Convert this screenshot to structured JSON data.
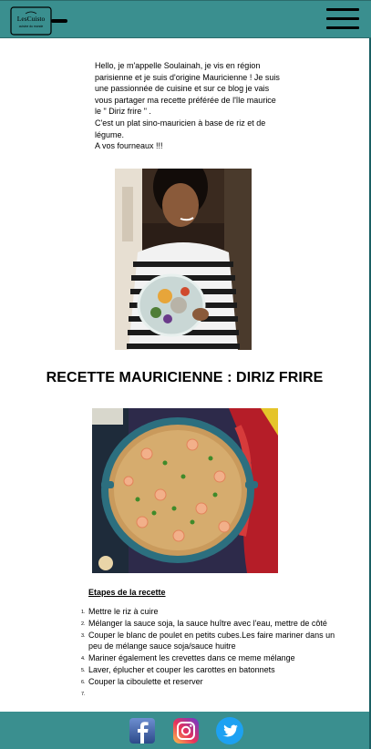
{
  "header": {
    "logo_text": "LesCuisto",
    "logo_subtext": "cuisine du monde",
    "menu_icon": "hamburger-icon"
  },
  "intro": {
    "p1": "Hello, je m'appelle Soulainah, je vis en région parisienne et je suis d'origine Mauricienne ! Je suis une passionnée de cuisine et sur ce blog je vais vous partager ma recette préférée de l'île maurice le \" Diriz frire \" .",
    "p2": "C'est un plat sino-mauricien à base de riz et de légume.",
    "p3": "A vos fourneaux !!!"
  },
  "title": "RECETTE MAURICIENNE : DIRIZ FRIRE",
  "steps": {
    "heading": "Etapes de la recette",
    "items": [
      {
        "num": "1.",
        "text": "Mettre le riz à cuire"
      },
      {
        "num": "2.",
        "text": "Mélanger la sauce soja, la sauce huître avec l'eau, mettre de côté"
      },
      {
        "num": "3.",
        "text": "Couper le blanc de poulet en petits cubes.Les faire mariner dans un peu de mélange sauce soja/sauce huitre"
      },
      {
        "num": "4.",
        "text": "Mariner également les crevettes dans ce meme mélange"
      },
      {
        "num": "5.",
        "text": "Laver, éplucher et couper les carottes en batonnets"
      },
      {
        "num": "6.",
        "text": "Couper la ciboulette et reserver"
      },
      {
        "num": "7.",
        "text": ""
      }
    ]
  },
  "footer": {
    "icons": [
      "facebook-icon",
      "instagram-icon",
      "twitter-icon"
    ]
  },
  "colors": {
    "header_bg": "#3a8f8f",
    "footer_bg": "#3a8f8f",
    "facebook": "#3b5998",
    "twitter": "#1da1f2"
  }
}
